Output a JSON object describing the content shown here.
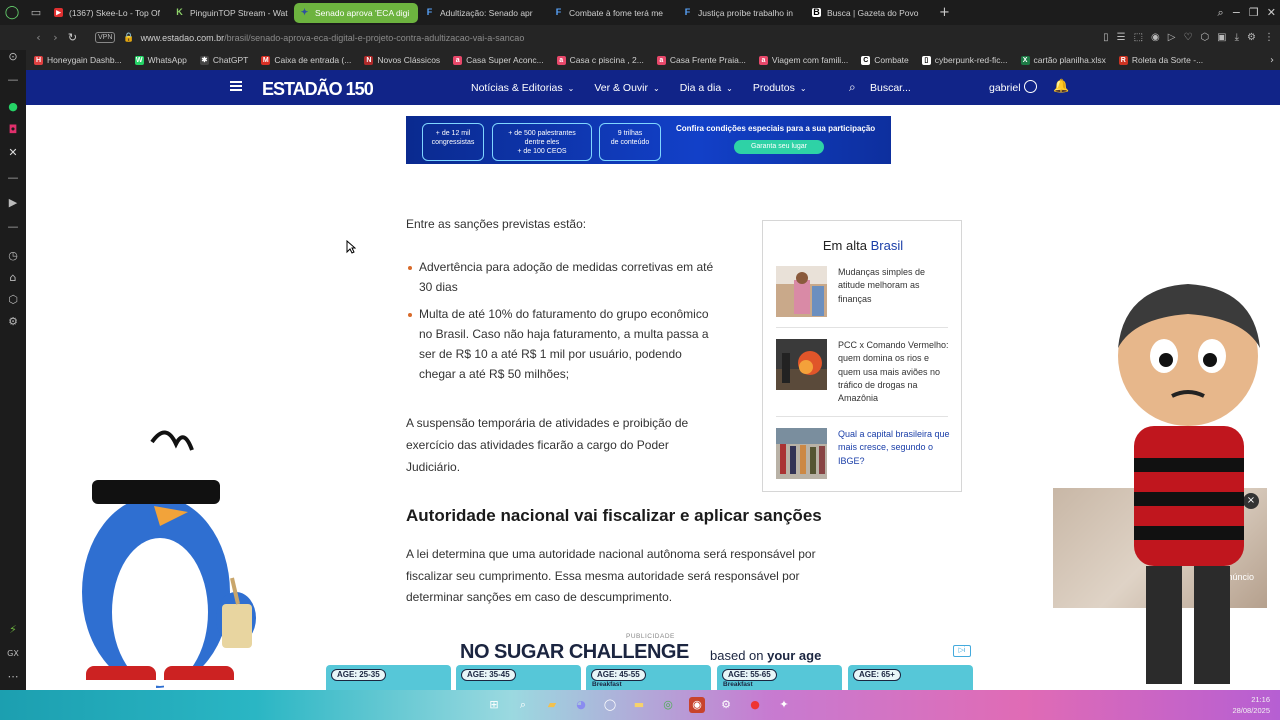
{
  "browser": {
    "tabs": [
      {
        "label": "(1367) Skee-Lo - Top Of",
        "active": false
      },
      {
        "label": "PinguinTOP Stream - Wat",
        "active": false
      },
      {
        "label": "Senado aprova 'ECA digi",
        "active": true
      },
      {
        "label": "Adultização: Senado apr",
        "active": false
      },
      {
        "label": "Combate à fome terá me",
        "active": false
      },
      {
        "label": "Justiça proíbe trabalho in",
        "active": false
      },
      {
        "label": "Busca | Gazeta do Povo",
        "active": false
      }
    ],
    "new_tab": "+",
    "vpn_label": "VPN",
    "url_host": "www.estadao.com.br",
    "url_path": "/brasil/senado-aprova-eca-digital-e-projeto-contra-adultizacao-vai-a-sancao",
    "bookmarks": [
      "Honeygain Dashb...",
      "WhatsApp",
      "ChatGPT",
      "Caixa de entrada (...",
      "Novos Clássicos",
      "Casa Super Aconc...",
      "Casa c piscina , 2...",
      "Casa Frente Praia...",
      "Viagem com famili...",
      "Combate",
      "cyberpunk-red-fic...",
      "cartão planilha.xlsx",
      "Roleta da Sorte -..."
    ]
  },
  "site": {
    "logo": "ESTADÃO 150",
    "menu": [
      "Notícias & Editorias",
      "Ver & Ouvir",
      "Dia a dia",
      "Produtos"
    ],
    "search_label": "Buscar...",
    "user_name": "gabriel"
  },
  "banner": {
    "pill1_a": "+ de 12 mil",
    "pill1_b": "congressistas",
    "pill2_a": "+ de 500 palestrantes",
    "pill2_b": "dentre eles",
    "pill2_c": "+ de 100 CEOS",
    "pill3_a": "9 trilhas",
    "pill3_b": "de conteúdo",
    "cta_text": "Confira condições especiais para a sua participação",
    "cta_button": "Garanta seu lugar"
  },
  "article": {
    "intro": "Entre as sanções previstas estão:",
    "bullet1_line1": "Advertência para adoção de medidas corretivas em até",
    "bullet1_line2": "30 dias",
    "bullet2_line1": "Multa de até 10% do faturamento do grupo econômico",
    "bullet2_line2": "no Brasil. Caso não haja faturamento, a multa passa a",
    "bullet2_line3": "ser de R$ 10 a até R$ 1 mil por usuário, podendo",
    "bullet2_line4": "chegar a até R$ 50 milhões;",
    "para1_line1": "A suspensão temporária de atividades e proibição de",
    "para1_line2": "exercício das atividades ficarão a cargo do Poder",
    "para1_line3": "Judiciário.",
    "heading": "Autoridade nacional vai fiscalizar e aplicar sanções",
    "para2_line1": "A lei determina que uma autoridade nacional autônoma será responsável por",
    "para2_line2": "fiscalizar seu cumprimento. Essa mesma autoridade será responsável por",
    "para2_line3": "determinar sanções em caso de descumprimento."
  },
  "trending": {
    "title_prefix": "Em alta",
    "title_section": "Brasil",
    "items": [
      {
        "title": "Mudanças simples de atitude melhoram as finanças"
      },
      {
        "title": "PCC x Comando Vermelho: quem domina os rios e quem usa mais aviões no tráfico de drogas na Amazônia"
      },
      {
        "title": "Qual a capital brasileira que mais cresce, segundo o IBGE?"
      }
    ]
  },
  "bottom_ad": {
    "label": "PUBLICIDADE",
    "headline": "NO SUGAR CHALLENGE",
    "sub_prefix": "based on",
    "sub_bold": "your age",
    "cards": [
      "AGE: 25-35",
      "AGE: 35-45",
      "AGE: 45-55",
      "AGE: 55-65",
      "AGE: 65+"
    ],
    "card3_extra": "Breakfast",
    "card4_extra": "Breakfast"
  },
  "video_ad": {
    "close": "×",
    "skip_label": "Pular anúncio"
  },
  "taskbar": {
    "time": "21:16",
    "date": "28/08/2025"
  },
  "colors": {
    "site_nav": "#112488",
    "active_tab": "#6db33f",
    "bullet": "#d86a2a",
    "brand_link": "#1a3ea8"
  }
}
